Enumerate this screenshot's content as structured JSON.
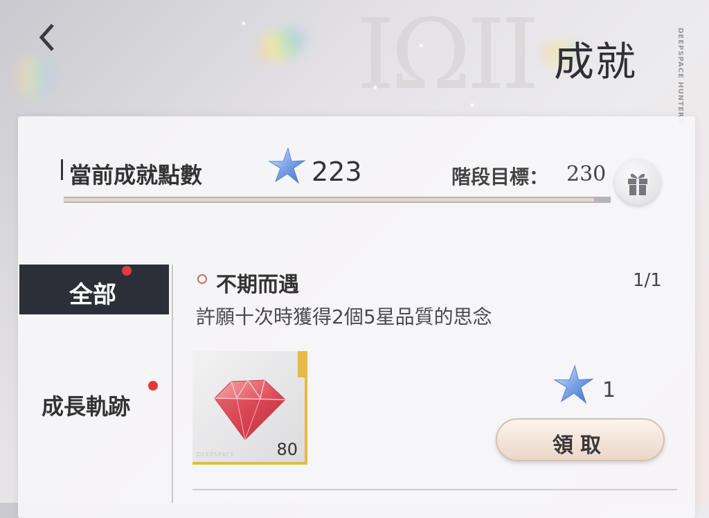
{
  "header": {
    "title": "成就",
    "watermark_brand": "DEEPSPACE HUNTERS"
  },
  "points": {
    "label": "當前成就點數",
    "value": "223",
    "goal_label": "階段目標：",
    "goal_value": "230",
    "progress_fraction": 0.97
  },
  "sidebar": {
    "items": [
      {
        "label": "全部",
        "active": true,
        "has_dot": true
      },
      {
        "label": "成長軌跡",
        "active": false,
        "has_dot": true
      }
    ]
  },
  "achievement": {
    "title": "不期而遇",
    "progress": "1/1",
    "description": "許願十次時獲得2個5星品質的思念",
    "reward_item": {
      "icon": "gem-icon",
      "count": "80",
      "brand": "DEEPSPACE"
    },
    "points_reward": "1",
    "claim_label": "領取"
  },
  "colors": {
    "active_tab_bg": "#2c2f37",
    "notification_dot": "#e23b3e",
    "reward_border": "#e9b946",
    "star": "#7aa6e8"
  }
}
